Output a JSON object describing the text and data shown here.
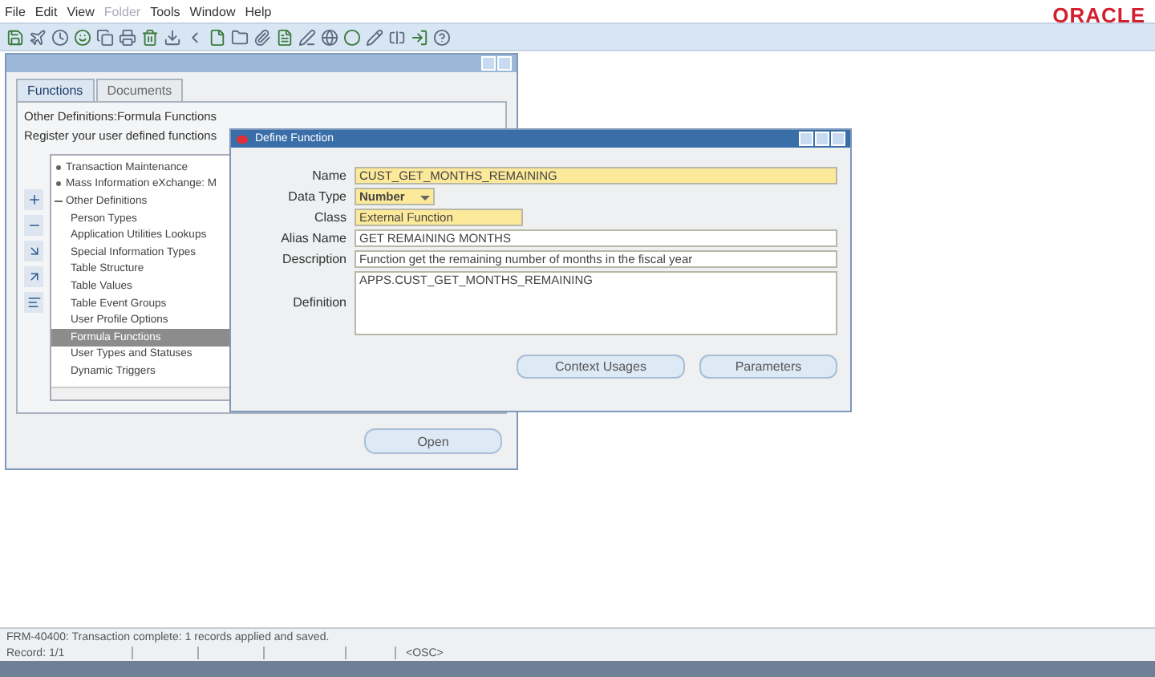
{
  "menu": [
    {
      "label": "File",
      "disabled": false
    },
    {
      "label": "Edit",
      "disabled": false
    },
    {
      "label": "View",
      "disabled": false
    },
    {
      "label": "Folder",
      "disabled": true
    },
    {
      "label": "Tools",
      "disabled": false
    },
    {
      "label": "Window",
      "disabled": false
    },
    {
      "label": "Help",
      "disabled": false
    }
  ],
  "logo": "ORACLE",
  "navigator": {
    "tabs": [
      {
        "label": "Functions",
        "selected": true
      },
      {
        "label": "Documents",
        "selected": false
      }
    ],
    "path": "Other Definitions:Formula Functions",
    "hint": "Register your user defined functions",
    "tree": [
      {
        "label": "Transaction Maintenance",
        "expanded": false,
        "selected": false
      },
      {
        "label": "Mass Information eXchange: M",
        "expanded": false,
        "selected": false
      },
      {
        "label": "Other Definitions",
        "expanded": true,
        "selected": false,
        "children": [
          {
            "label": "Person Types",
            "selected": false
          },
          {
            "label": "Application Utilities Lookups",
            "selected": false
          },
          {
            "label": "Special Information Types",
            "selected": false
          },
          {
            "label": "Table Structure",
            "selected": false
          },
          {
            "label": "Table Values",
            "selected": false
          },
          {
            "label": "Table Event Groups",
            "selected": false
          },
          {
            "label": "User Profile Options",
            "selected": false
          },
          {
            "label": "Formula Functions",
            "selected": true
          },
          {
            "label": "User Types and Statuses",
            "selected": false
          },
          {
            "label": "Dynamic Triggers",
            "selected": false
          }
        ]
      }
    ],
    "open_button": "Open"
  },
  "dialog": {
    "title": "Define Function",
    "fields": [
      {
        "label": "Name",
        "value": "CUST_GET_MONTHS_REMAINING",
        "kind": "text",
        "required": true
      },
      {
        "label": "Data Type",
        "value": "Number",
        "kind": "select",
        "required": true
      },
      {
        "label": "Class",
        "value": "External Function",
        "kind": "short",
        "required": true
      },
      {
        "label": "Alias Name",
        "value": "GET REMAINING MONTHS",
        "kind": "text",
        "required": false
      },
      {
        "label": "Description",
        "value": "Function get the remaining number of months in the fiscal year",
        "kind": "text",
        "required": false
      },
      {
        "label": "Definition",
        "value": "APPS.CUST_GET_MONTHS_REMAINING",
        "kind": "textarea",
        "required": false
      }
    ],
    "buttons": [
      "Context Usages",
      "Parameters"
    ]
  },
  "status_bar": {
    "message": "FRM-40400: Transaction complete: 1 records applied and saved.",
    "record": "Record: 1/1",
    "mode": "<OSC>"
  }
}
